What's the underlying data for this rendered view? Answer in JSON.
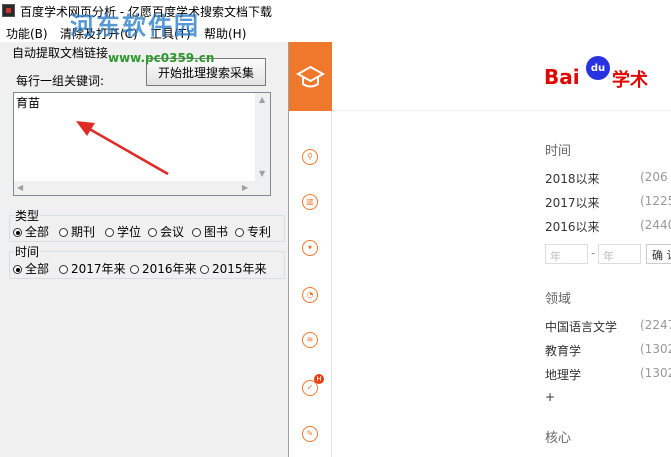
{
  "window": {
    "title": "百度学术网页分析 - 亿愿百度学术搜索文档下载"
  },
  "menu": [
    {
      "label": "功能(B)"
    },
    {
      "label": "清除及打开(C)"
    },
    {
      "label": "工具(T)"
    },
    {
      "label": "帮助(H)"
    }
  ],
  "watermark": {
    "main": "河东软件园",
    "url": "www.pc0359.cn"
  },
  "left_panel": {
    "group_tab": "自动提取文档链接",
    "keywords_label": "每行一组关键词:",
    "batch_button": "开始批理搜索采集",
    "keywords_value": "育苗",
    "type_group": {
      "legend": "类型",
      "options": [
        "全部",
        "期刊",
        "学位",
        "会议",
        "图书",
        "专利"
      ],
      "selected": "全部"
    },
    "time_group": {
      "legend": "时间",
      "options": [
        "全部",
        "2017年来",
        "2016年来",
        "2015年来"
      ],
      "selected": "全部"
    }
  },
  "sidebar": {
    "icons": [
      "graduation-cap-icon",
      "search-icon",
      "library-icon",
      "download-icon",
      "rss-icon",
      "layers-icon",
      "check-icon",
      "edit-icon"
    ],
    "badge": "H"
  },
  "baidu": {
    "logo_bai": "Bai",
    "logo_du": "du",
    "logo_xueshu": "学术",
    "time_section": "时间",
    "time_filters": [
      {
        "label": "2018以来",
        "count": "(206"
      },
      {
        "label": "2017以来",
        "count": "(1225"
      },
      {
        "label": "2016以来",
        "count": "(2440"
      }
    ],
    "year_from_placeholder": "年",
    "year_sep": "-",
    "year_to_placeholder": "年",
    "confirm_label": "确 认",
    "field_section": "领域",
    "field_filters": [
      {
        "label": "中国语言文学",
        "count": "(2247"
      },
      {
        "label": "教育学",
        "count": "(1302"
      },
      {
        "label": "地理学",
        "count": "(1302"
      }
    ],
    "more_label": "+",
    "core_section": "核心"
  },
  "colors": {
    "accent_orange": "#f0782d",
    "baidu_red": "#e10601",
    "baidu_blue": "#2932e1",
    "arrow_red": "#e02a25"
  }
}
